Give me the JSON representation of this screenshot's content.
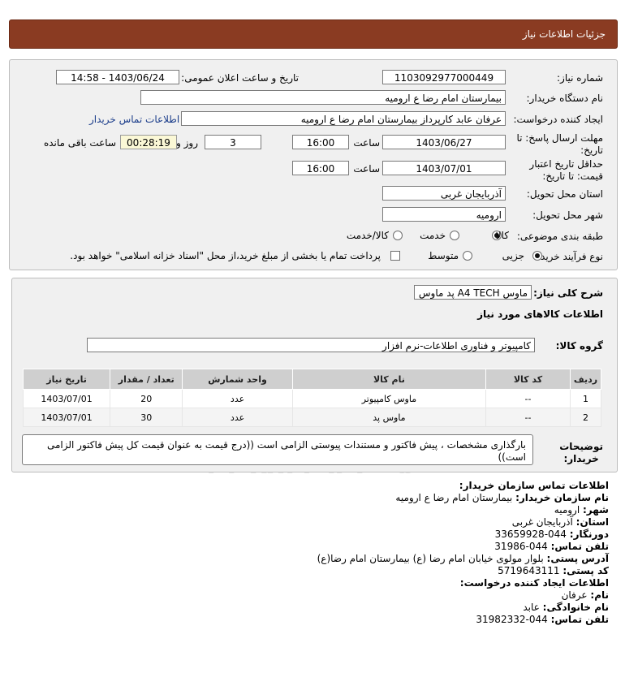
{
  "header": {
    "title": "جزئیات اطلاعات نیاز"
  },
  "form": {
    "need_number_label": "شماره نیاز:",
    "need_number": "1103092977000449",
    "announce_label": "تاریخ و ساعت اعلان عمومی:",
    "announce_value": "1403/06/24 - 14:58",
    "buyer_label": "نام دستگاه خریدار:",
    "buyer_value": "بیمارستان امام رضا  ع  ارومیه",
    "creator_label": "ایجاد کننده درخواست:",
    "creator_value": "عرفان عابد کارپرداز بیمارستان امام رضا  ع  ارومیه",
    "contact_link": "اطلاعات تماس خریدار",
    "deadline_label_1": "مهلت ارسال پاسخ: تا",
    "deadline_label_2": "تاریخ:",
    "deadline_date": "1403/06/27",
    "time_label": "ساعت",
    "deadline_time": "16:00",
    "days_value": "3",
    "days_label": "روز و",
    "remaining_value": "00:28:19",
    "remaining_label": "ساعت باقی مانده",
    "validity_label_1": "حداقل تاریخ اعتبار",
    "validity_label_2": "قیمت: تا تاریخ:",
    "validity_date": "1403/07/01",
    "validity_time": "16:00",
    "province_label": "استان محل تحویل:",
    "province_value": "آذربایجان غربی",
    "city_label": "شهر محل تحویل:",
    "city_value": "ارومیه",
    "category_label": "طبقه بندی موضوعی:",
    "category_options": [
      "کالا",
      "خدمت",
      "کالا/خدمت"
    ],
    "category_selected": "کالا",
    "process_label": "نوع فرآیند خرید :",
    "process_options": [
      "جزیی",
      "متوسط"
    ],
    "process_selected": "جزیی",
    "payment_note": "پرداخت تمام یا بخشی از مبلغ خرید،از محل \"اسناد خزانه اسلامی\" خواهد بود."
  },
  "need": {
    "summary_label": "شرح کلی نیاز:",
    "summary_value": "ماوس A4 TECH پد ماوس",
    "goods_title": "اطلاعات کالاهای مورد نیاز",
    "group_label": "گروه کالا:",
    "group_value": "کامپیوتر و فناوری اطلاعات-نرم افزار",
    "columns": [
      "ردیف",
      "کد کالا",
      "نام کالا",
      "واحد شمارش",
      "تعداد / مقدار",
      "تاریخ نیاز"
    ],
    "rows": [
      {
        "idx": "1",
        "code": "--",
        "name": "ماوس کامپیوتر",
        "unit": "عدد",
        "qty": "20",
        "date": "1403/07/01"
      },
      {
        "idx": "2",
        "code": "--",
        "name": "ماوس پد",
        "unit": "عدد",
        "qty": "30",
        "date": "1403/07/01"
      }
    ],
    "notes_label_1": "توضیحات",
    "notes_label_2": "خریدار:",
    "notes_value": "بارگذاری مشخصات ، پیش فاکتور و مستندات پیوستی الزامی است ((درج قیمت به عنوان قیمت کل پیش فاکتور الزامی است))"
  },
  "contact": {
    "title": "اطلاعات تماس سازمان خریدار:",
    "org_label": "نام سازمان خریدار:",
    "org_value": "بیمارستان امام رضا ع ارومیه",
    "city_label": "شهر:",
    "city_value": "ارومیه",
    "province_label": "استان:",
    "province_value": "آذربایجان غربی",
    "fax_label": "دورنگار:",
    "fax_value": "044-33659928",
    "phone_label": "تلفن تماس:",
    "phone_value": "044-31986",
    "address_label": "آدرس پستی:",
    "address_value": "بلوار مولوی خیابان امام رضا (ع) بیمارستان امام رضا(ع)",
    "postal_label": "کد پستی:",
    "postal_value": "5719643111",
    "creator_title": "اطلاعات ایجاد کننده درخواست:",
    "name_label": "نام:",
    "name_value": "عرفان",
    "family_label": "نام خانوادگی:",
    "family_value": "عابد",
    "creator_phone_label": "تلفن تماس:",
    "creator_phone_value": "044-31982332"
  },
  "watermark": {
    "brand": "ParsNamadData",
    "phone": "۰۲۱-۸۸۳۴۹۶۷۰-۵"
  }
}
